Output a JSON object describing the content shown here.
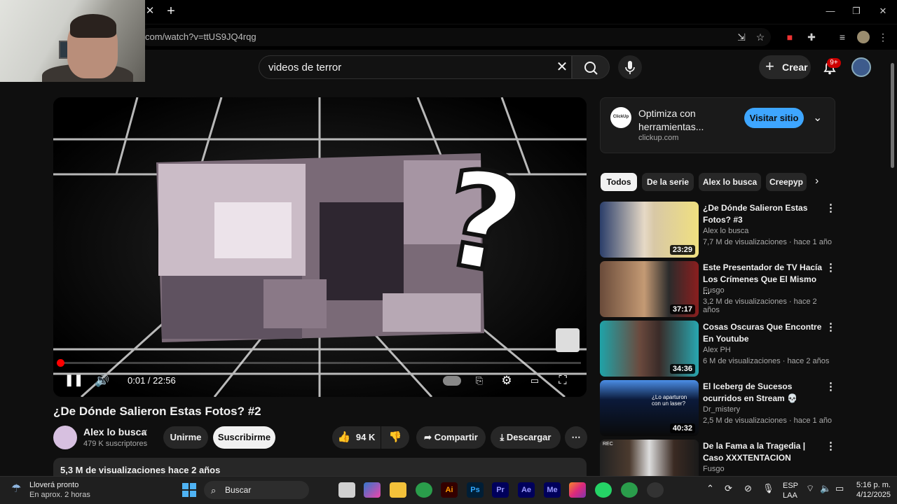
{
  "browser": {
    "tab_close": "✕",
    "new_tab": "+",
    "url": "com/watch?v=ttUS9JQ4rqg",
    "window_buttons": [
      "—",
      "❐",
      "✕"
    ]
  },
  "masthead": {
    "search_value": "videos de terror",
    "create_label": "Crear",
    "notifications_badge": "9+"
  },
  "player": {
    "time": "0:01 / 22:56",
    "progress": 0.0007
  },
  "video": {
    "title": "¿De Dónde Salieron Estas Fotos? #2",
    "channel": "Alex lo busca",
    "subscribers": "479 K suscriptores",
    "join_label": "Unirme",
    "subscribe_label": "Suscribirme",
    "likes": "94 K",
    "share_label": "Compartir",
    "download_label": "Descargar",
    "views_line": "5,3 M de visualizaciones  hace 2 años"
  },
  "ad": {
    "title": "Optimiza con herramientas...",
    "domain": "clickup.com",
    "logo_text": "ClickUp",
    "button_label": "Visitar sitio"
  },
  "chips": [
    "Todos",
    "De la serie",
    "Alex lo busca",
    "Creepyp"
  ],
  "related": [
    {
      "title": "¿De Dónde Salieron Estas Fotos? #3",
      "channel": "Alex lo busca",
      "meta": "7,7 M de visualizaciones · hace 1 año",
      "duration": "23:29"
    },
    {
      "title": "Este Presentador de TV Hacía Los Crímenes Que El Mismo ...",
      "channel": "Fusgo",
      "meta": "3,2 M de visualizaciones · hace 2 años",
      "duration": "37:17"
    },
    {
      "title": "Cosas Oscuras Que Encontre En Youtube",
      "channel": "Alex PH",
      "meta": "6 M de visualizaciones · hace 2 años",
      "duration": "34:36"
    },
    {
      "title": "El Iceberg de Sucesos ocurridos en Stream 💀",
      "channel": "Dr_mistery",
      "meta": "2,5 M de visualizaciones · hace 1 año",
      "duration": "40:32"
    },
    {
      "title": "De la Fama a la Tragedia | Caso XXXTENTACION",
      "channel": "Fusgo",
      "meta": "",
      "duration": ""
    }
  ],
  "thumb_texts": {
    "rec": "REC",
    "iceberg_caption": "¿Lo aparturon con un laser?"
  },
  "taskbar": {
    "weather_title": "Lloverá pronto",
    "weather_sub": "En aprox. 2 horas",
    "search_placeholder": "Buscar",
    "lang_top": "ESP",
    "lang_bottom": "LAA",
    "time": "5:16 p. m.",
    "date": "4/12/2025",
    "apps": [
      "Ai",
      "Ps",
      "Pr",
      "Ae",
      "Me"
    ]
  },
  "colors": {
    "accent_red": "#ff0000",
    "link_blue": "#3ea6ff",
    "bg": "#0f0f0f"
  }
}
